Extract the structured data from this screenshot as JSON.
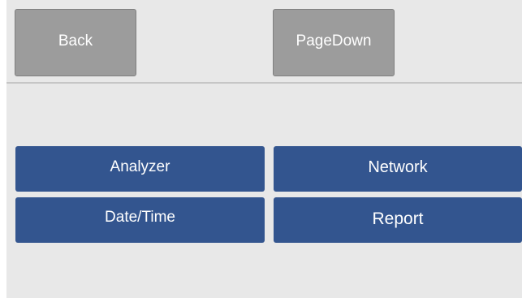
{
  "toolbar": {
    "back_label": "Back",
    "pagedown_label": "PageDown"
  },
  "menu": {
    "items": [
      {
        "label": "Analyzer"
      },
      {
        "label": "Network"
      },
      {
        "label": "Date/Time"
      },
      {
        "label": "Report"
      }
    ]
  },
  "colors": {
    "background": "#e8e8e8",
    "toolbar_button": "#9c9c9c",
    "menu_button": "#33558f",
    "button_text": "#ffffff"
  }
}
